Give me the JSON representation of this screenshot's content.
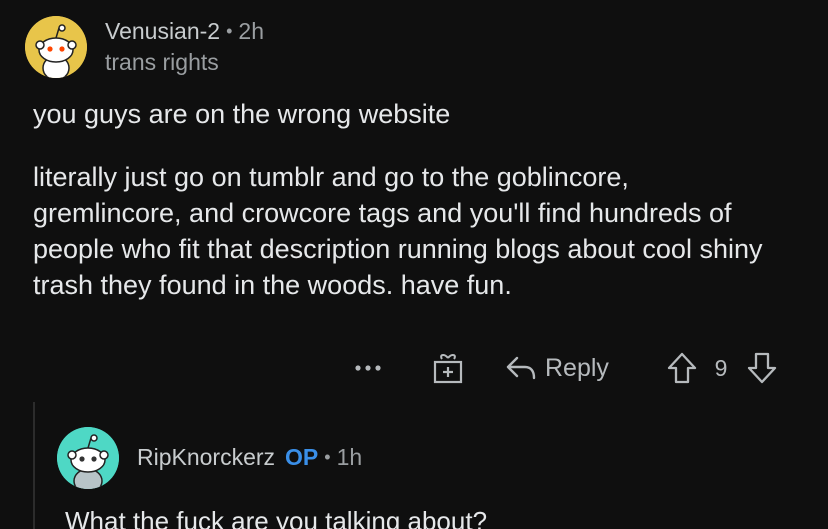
{
  "comment1": {
    "username": "Venusian-2",
    "separator": "•",
    "time": "2h",
    "flair": "trans rights",
    "avatar_color": "#e8c54a",
    "paragraphs": [
      "you guys are on the wrong website",
      "literally just go on tumblr and go to the goblincore, gremlincore, and crowcore tags and you'll find hundreds of people who fit that description running blogs about cool shiny trash they found in the woods. have fun."
    ]
  },
  "actions": {
    "more_icon": "more-dots-icon",
    "award_icon": "gift-icon",
    "reply_icon": "reply-arrow-icon",
    "reply_label": "Reply",
    "upvote_icon": "upvote-arrow-icon",
    "score": "9",
    "downvote_icon": "downvote-arrow-icon"
  },
  "comment2": {
    "username": "RipKnorckerz",
    "op_badge": "OP",
    "separator": "•",
    "time": "1h",
    "avatar_color": "#4ed8c5",
    "text": "What the fuck are you talking about?"
  },
  "colors": {
    "background": "#0f0f0f",
    "op_blue": "#3a8fe8",
    "muted": "#9a9ea1"
  }
}
